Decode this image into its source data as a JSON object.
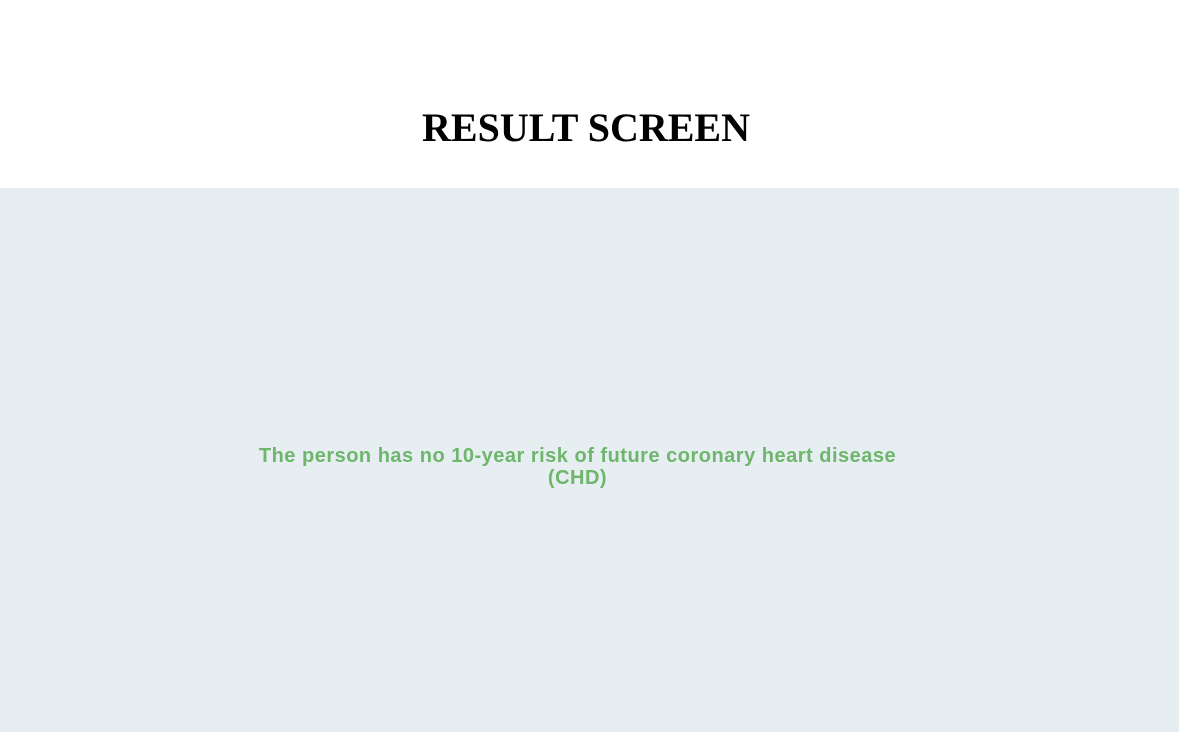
{
  "header": {
    "title": "RESULT SCREEN"
  },
  "result": {
    "message": "The person has no 10-year risk of future coronary heart disease (CHD)"
  },
  "colors": {
    "page_background": "#ffffff",
    "panel_background": "#e7eef2",
    "title_text": "#000000",
    "result_text": "#6db66b"
  }
}
